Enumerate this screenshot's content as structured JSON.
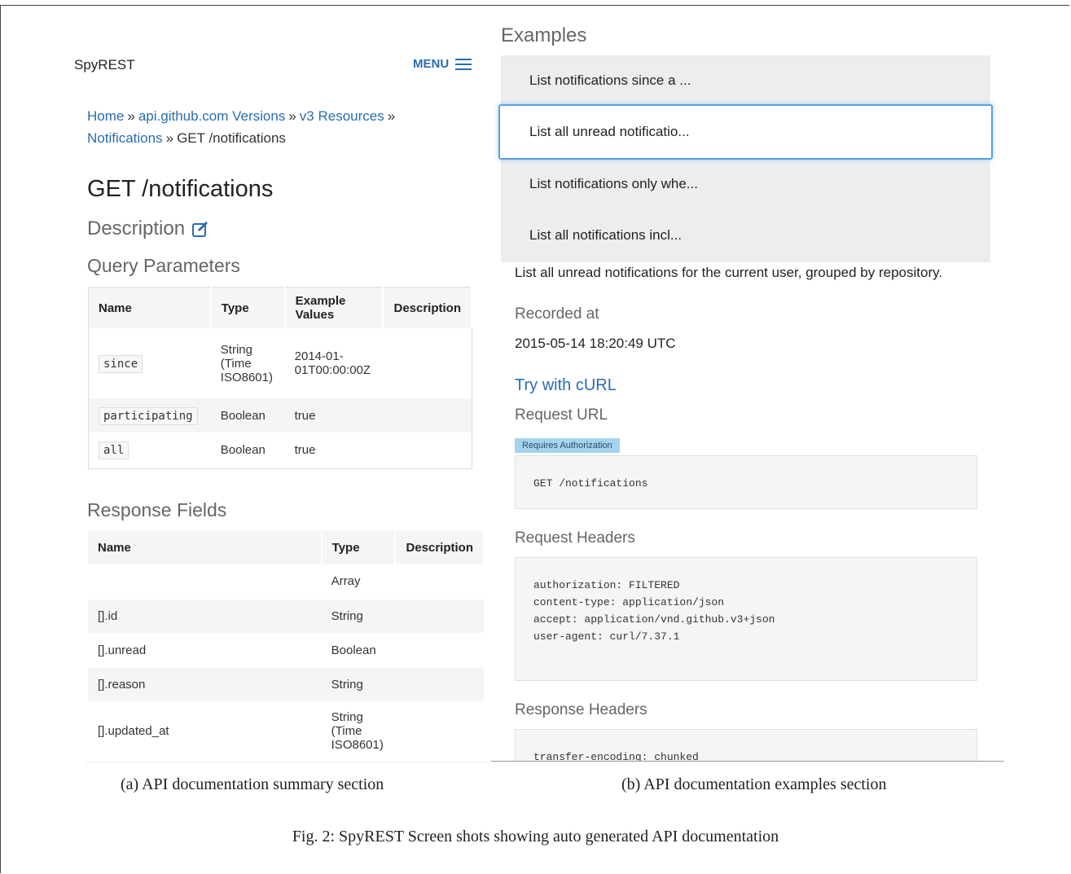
{
  "left": {
    "brand": "SpyREST",
    "menu_label": "MENU",
    "breadcrumb": [
      {
        "label": "Home",
        "link": true
      },
      {
        "label": "api.github.com Versions",
        "link": true
      },
      {
        "label": "v3 Resources",
        "link": true
      },
      {
        "label": "Notifications",
        "link": true
      },
      {
        "label": "GET /notifications",
        "link": false
      }
    ],
    "breadcrumb_sep": "»",
    "title": "GET /notifications",
    "description_heading": "Description",
    "query_heading": "Query Parameters",
    "query_table": {
      "headers": [
        "Name",
        "Type",
        "Example Values",
        "Description"
      ],
      "rows": [
        {
          "name": "since",
          "type": "String (Time ISO8601)",
          "example": "2014-01-01T00:00:00Z",
          "description": ""
        },
        {
          "name": "participating",
          "type": "Boolean",
          "example": "true",
          "description": ""
        },
        {
          "name": "all",
          "type": "Boolean",
          "example": "true",
          "description": ""
        }
      ]
    },
    "response_heading": "Response Fields",
    "response_table": {
      "headers": [
        "Name",
        "Type",
        "Description"
      ],
      "rows": [
        {
          "name": "",
          "type": "Array",
          "description": ""
        },
        {
          "name": "[].id",
          "type": "String",
          "description": ""
        },
        {
          "name": "[].unread",
          "type": "Boolean",
          "description": ""
        },
        {
          "name": "[].reason",
          "type": "String",
          "description": ""
        },
        {
          "name": "[].updated_at",
          "type": "String (Time ISO8601)",
          "description": ""
        }
      ]
    }
  },
  "right": {
    "examples_heading": "Examples",
    "examples": [
      {
        "label": "List notifications since a ...",
        "active": false
      },
      {
        "label": "List all unread notificatio...",
        "active": true
      },
      {
        "label": "List notifications only whe...",
        "active": false
      },
      {
        "label": "List all notifications incl...",
        "active": false
      }
    ],
    "summary": "List all unread notifications for the current user, grouped by repository.",
    "recorded_label": "Recorded at",
    "recorded_value": "2015-05-14 18:20:49 UTC",
    "try_label": "Try with cURL",
    "request_url_heading": "Request URL",
    "auth_badge": "Requires Authorization",
    "request_url": "GET /notifications",
    "request_headers_heading": "Request Headers",
    "request_headers": "authorization: FILTERED\ncontent-type: application/json\naccept: application/vnd.github.v3+json\nuser-agent: curl/7.37.1",
    "response_headers_heading": "Response Headers",
    "response_headers": "transfer-encoding: chunked"
  },
  "captions": {
    "a": "(a) API documentation summary section",
    "b": "(b) API documentation examples section",
    "figure": "Fig. 2: SpyREST Screen shots showing auto generated API documentation"
  },
  "colors": {
    "link": "#2a6db0",
    "active_border": "#5aa0e6",
    "badge_bg": "#a4d3ee",
    "panel_bg": "#ededed"
  }
}
